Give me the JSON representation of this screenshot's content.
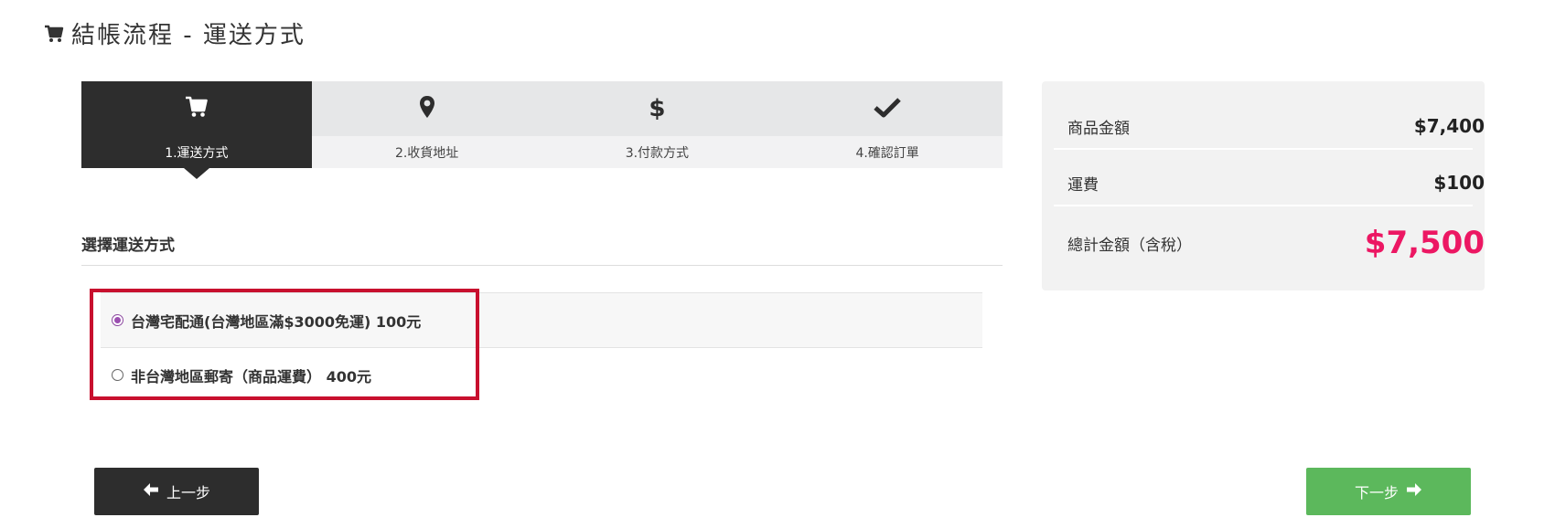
{
  "page": {
    "title": "結帳流程 - 運送方式"
  },
  "steps": [
    {
      "label": "1.運送方式",
      "icon": "cart-icon",
      "active": true
    },
    {
      "label": "2.收貨地址",
      "icon": "map-marker-icon",
      "active": false
    },
    {
      "label": "3.付款方式",
      "icon": "dollar-icon",
      "symbol": "$",
      "active": false
    },
    {
      "label": "4.確認訂單",
      "icon": "check-icon",
      "active": false
    }
  ],
  "shipping": {
    "heading": "選擇運送方式",
    "options": [
      {
        "label": "台灣宅配通(台灣地區滿$3000免運) 100元",
        "selected": true
      },
      {
        "label": "非台灣地區郵寄（商品運費） 400元",
        "selected": false
      }
    ]
  },
  "buttons": {
    "prev_label": "上一步",
    "next_label": "下一步"
  },
  "summary": {
    "goods_label": "商品金額",
    "goods_value": "$7,400",
    "shipping_label": "運費",
    "shipping_value": "$100",
    "total_label": "總計金額（含稅）",
    "total_value": "$7,500"
  },
  "colors": {
    "active_step": "#2d2d2d",
    "highlight_border": "#c8102e",
    "total_accent": "#ec1763",
    "next_button": "#5cb85c",
    "radio_selected": "#9b4fb0"
  }
}
